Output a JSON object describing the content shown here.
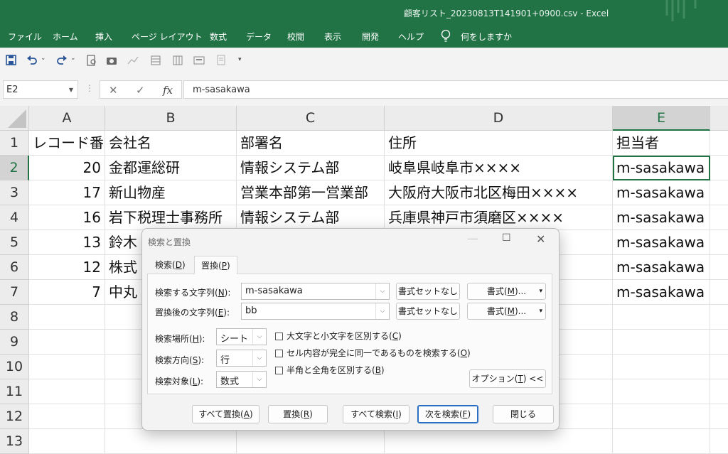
{
  "window": {
    "title": "顧客リスト_20230813T141901+0900.csv  -  Excel"
  },
  "ribbon": {
    "tabs": [
      "ファイル",
      "ホーム",
      "挿入",
      "ページ レイアウト",
      "数式",
      "データ",
      "校閲",
      "表示",
      "開発",
      "ヘルプ"
    ],
    "tell_me": "何をしますか"
  },
  "formula_bar": {
    "name_box": "E2",
    "fx": "fx",
    "formula": "m-sasakawa"
  },
  "sheet": {
    "columns": [
      "A",
      "B",
      "C",
      "D",
      "E"
    ],
    "rows": [
      "1",
      "2",
      "3",
      "4",
      "5",
      "6",
      "7",
      "8",
      "9",
      "10",
      "11",
      "12",
      "13"
    ],
    "cells": [
      [
        "レコード番号",
        "会社名",
        "部署名",
        "住所",
        "担当者"
      ],
      [
        "20",
        "金都運総研",
        "情報システム部",
        "岐阜県岐阜市××××",
        "m-sasakawa"
      ],
      [
        "17",
        "新山物産",
        "営業本部第一営業部",
        "大阪府大阪市北区梅田××××",
        "m-sasakawa"
      ],
      [
        "16",
        "岩下税理士事務所",
        "情報システム部",
        "兵庫県神戸市須磨区××××",
        "m-sasakawa"
      ],
      [
        "13",
        "鈴木",
        "",
        "×",
        "m-sasakawa"
      ],
      [
        "12",
        "株式",
        "",
        "",
        "m-sasakawa"
      ],
      [
        "7",
        "中丸",
        "",
        "",
        "m-sasakawa"
      ]
    ]
  },
  "dialog": {
    "title": "検索と置換",
    "tabs": [
      {
        "label": "検索(D)",
        "pre": "検索(",
        "key": "D",
        "post": ")"
      },
      {
        "label": "置換(P)",
        "pre": "置換(",
        "key": "P",
        "post": ")"
      }
    ],
    "find": {
      "label_pre": "検索する文字列(",
      "label_key": "N",
      "label_post": "):",
      "value": "m-sasakawa",
      "no_format": "書式セットなし",
      "format_pre": "書式(",
      "format_key": "M",
      "format_post": ")..."
    },
    "replace": {
      "label_pre": "置換後の文字列(",
      "label_key": "E",
      "label_post": "):",
      "value": "bb",
      "no_format": "書式セットなし",
      "format_pre": "書式(",
      "format_key": "M",
      "format_post": ")..."
    },
    "within": {
      "label_pre": "検索場所(",
      "label_key": "H",
      "label_post": "):",
      "value": "シート"
    },
    "search": {
      "label_pre": "検索方向(",
      "label_key": "S",
      "label_post": "):",
      "value": "行"
    },
    "look_in": {
      "label_pre": "検索対象(",
      "label_key": "L",
      "label_post": "):",
      "value": "数式"
    },
    "options": [
      {
        "pre": "大文字と小文字を区別する(",
        "key": "C",
        "post": ")",
        "checked": false
      },
      {
        "pre": "セル内容が完全に同一であるものを検索する(",
        "key": "O",
        "post": ")",
        "checked": false
      },
      {
        "pre": "半角と全角を区別する(",
        "key": "B",
        "post": ")",
        "checked": false
      }
    ],
    "options_button": {
      "pre": "オプション(",
      "key": "T",
      "post": ") <<"
    },
    "buttons": {
      "replace_all": {
        "pre": "すべて置換(",
        "key": "A",
        "post": ")"
      },
      "replace": {
        "pre": "置換(",
        "key": "R",
        "post": ")"
      },
      "find_all": {
        "pre": "すべて検索(",
        "key": "I",
        "post": ")"
      },
      "find_next": {
        "pre": "次を検索(",
        "key": "F",
        "post": ")"
      },
      "close": "閉じる"
    }
  }
}
